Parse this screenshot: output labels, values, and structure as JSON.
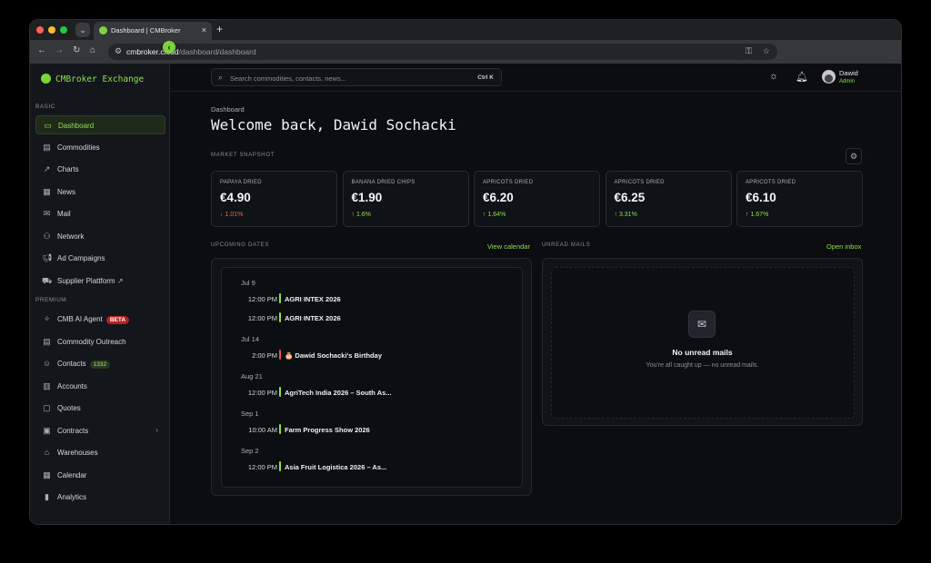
{
  "browser": {
    "tab_title": "Dashboard | CMBroker",
    "url_host": "cmbroker.cloud",
    "url_path": "/dashboard/dashboard"
  },
  "sidebar": {
    "brand": "CMBroker Exchange",
    "section_basic": "BASIC",
    "section_premium": "PREMIUM",
    "basic_items": [
      {
        "label": "Dashboard",
        "icon": "monitor-icon"
      },
      {
        "label": "Commodities",
        "icon": "box-icon"
      },
      {
        "label": "Charts",
        "icon": "trend-icon"
      },
      {
        "label": "News",
        "icon": "newspaper-icon"
      },
      {
        "label": "Mail",
        "icon": "mail-icon"
      },
      {
        "label": "Network",
        "icon": "network-icon"
      },
      {
        "label": "Ad Campaigns",
        "icon": "megaphone-icon"
      },
      {
        "label": "Supplier Plattform",
        "icon": "truck-icon"
      }
    ],
    "premium_items": [
      {
        "label": "CMB AI Agent",
        "icon": "sparkle-icon",
        "badge": "BETA"
      },
      {
        "label": "Commodity Outreach",
        "icon": "box-icon"
      },
      {
        "label": "Contacts",
        "icon": "users-icon",
        "badge": "1332"
      },
      {
        "label": "Accounts",
        "icon": "building-icon"
      },
      {
        "label": "Quotes",
        "icon": "file-icon"
      },
      {
        "label": "Contracts",
        "icon": "contract-icon"
      },
      {
        "label": "Warehouses",
        "icon": "warehouse-icon"
      },
      {
        "label": "Calendar",
        "icon": "calendar-icon"
      },
      {
        "label": "Analytics",
        "icon": "analytics-icon"
      }
    ]
  },
  "topbar": {
    "search_placeholder": "Search commodities, contacts, news...",
    "shortcut": "Ctrl K",
    "user_name": "Dawid",
    "user_role": "Admin"
  },
  "page": {
    "breadcrumb": "Dashboard",
    "welcome": "Welcome back, Dawid Sochacki",
    "market_label": "MARKET SNAPSHOT",
    "upcoming_label": "UPCOMING DATES",
    "view_calendar": "View calendar",
    "unread_label": "UNREAD MAILS",
    "open_inbox": "Open inbox"
  },
  "market": [
    {
      "name": "PAPAYA DRIED",
      "price": "€4.90",
      "change": "↓ 1.01%",
      "dir": "down"
    },
    {
      "name": "BANANA DRIED CHIPS",
      "price": "€1.90",
      "change": "↑ 1.6%",
      "dir": "up"
    },
    {
      "name": "APRICOTS DRIED",
      "price": "€6.20",
      "change": "↑ 1.64%",
      "dir": "up"
    },
    {
      "name": "APRICOTS DRIED",
      "price": "€6.25",
      "change": "↑ 3.31%",
      "dir": "up"
    },
    {
      "name": "APRICOTS DRIED",
      "price": "€6.10",
      "change": "↑ 1.67%",
      "dir": "up"
    }
  ],
  "events": {
    "groups": [
      {
        "date": "Jul 9",
        "items": [
          {
            "time": "12:00 PM",
            "name": "AGRI INTEX 2026"
          },
          {
            "time": "12:00 PM",
            "name": "AGRI INTEX 2026"
          }
        ]
      },
      {
        "date": "Jul 14",
        "items": [
          {
            "time": "2:00 PM",
            "name": "🎂 Dawid Sochacki's Birthday",
            "color": "red"
          }
        ]
      },
      {
        "date": "Aug 21",
        "items": [
          {
            "time": "12:00 PM",
            "name": "AgriTech India 2026 – South As..."
          }
        ]
      },
      {
        "date": "Sep 1",
        "items": [
          {
            "time": "10:00 AM",
            "name": "Farm Progress Show 2026"
          }
        ]
      },
      {
        "date": "Sep 2",
        "items": [
          {
            "time": "12:00 PM",
            "name": "Asia Fruit Logistica 2026 – As..."
          }
        ]
      }
    ]
  },
  "mails": {
    "empty_title": "No unread mails",
    "empty_sub": "You're all caught up — no unread mails."
  }
}
